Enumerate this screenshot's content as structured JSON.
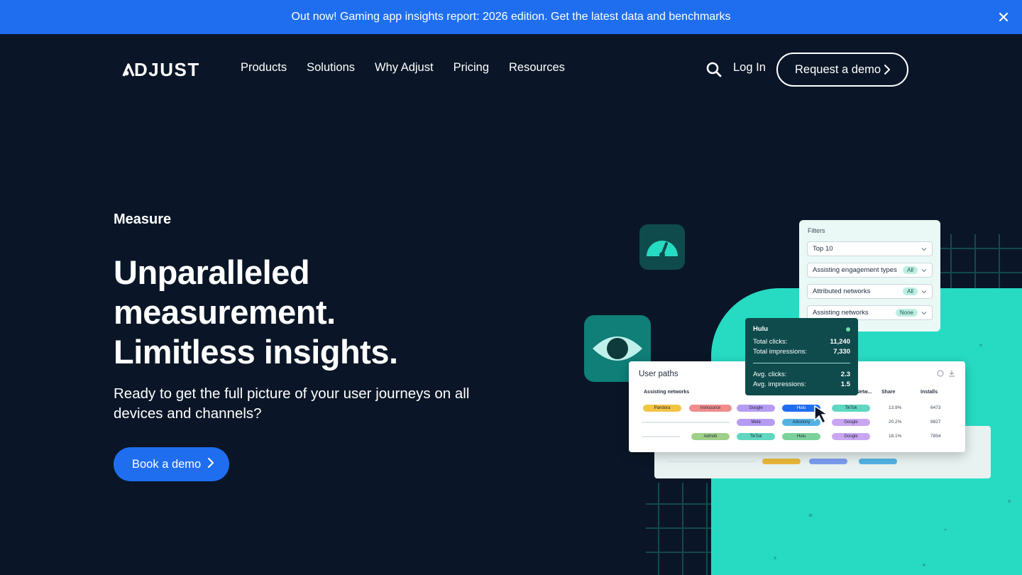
{
  "banner": {
    "text": "Out now! Gaming app insights report: 2026 edition. Get the latest data and benchmarks",
    "close_icon": "close-icon",
    "color": "#1f6ef0"
  },
  "nav": {
    "logo": "ADJUST",
    "links": [
      "Products",
      "Solutions",
      "Why Adjust",
      "Pricing",
      "Resources"
    ],
    "login": "Log In",
    "demo_button": "Request a demo"
  },
  "hero": {
    "eyebrow": "Measure",
    "title_lines": [
      "Unparalleled",
      "measurement.",
      "Limitless insights."
    ],
    "subtitle": "Ready to get the full picture of your user journeys on all devices and channels?",
    "cta": "Book a demo",
    "background": "#0a1627",
    "accent": "#27dbc3"
  },
  "filters": {
    "title": "Filters",
    "rows": [
      {
        "label": "Top 10",
        "pill": ""
      },
      {
        "label": "Assisting engagement types",
        "pill": "All"
      },
      {
        "label": "Attributed networks",
        "pill": "All"
      },
      {
        "label": "Assisting networks",
        "pill": "None"
      }
    ]
  },
  "tooltip": {
    "title": "Hulu",
    "rows": [
      {
        "label": "Total clicks:",
        "value": "11,240"
      },
      {
        "label": "Total impressions:",
        "value": "7,330"
      }
    ],
    "rows2": [
      {
        "label": "Avg. clicks:",
        "value": "2.3"
      },
      {
        "label": "Avg. impressions:",
        "value": "1.5"
      }
    ]
  },
  "user_paths": {
    "title": "User paths",
    "headers": {
      "assisting": "Assisting networks",
      "attributed": "Netw...",
      "share": "Share",
      "installs": "Installs"
    },
    "rows": [
      {
        "chips": [
          "Pandora",
          "Ironsource",
          "Google",
          "Hulu",
          "TikTok"
        ],
        "share": "13.9%",
        "installs": "6473"
      },
      {
        "chips": [
          "",
          "",
          "Meta",
          "Adcolony",
          "Google"
        ],
        "share": "20.2%",
        "installs": "9827"
      },
      {
        "chips": [
          "",
          "Admob",
          "TikTok",
          "Hulu",
          "Google"
        ],
        "share": "18.1%",
        "installs": "7854"
      }
    ]
  }
}
